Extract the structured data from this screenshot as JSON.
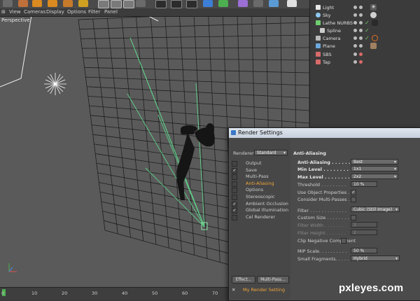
{
  "menu": {
    "items": [
      "View",
      "Cameras",
      "Display",
      "Options",
      "Filter",
      "Panel"
    ]
  },
  "viewport": {
    "label": "Perspective"
  },
  "timeline": {
    "ticks": [
      "0",
      "10",
      "20",
      "30",
      "40",
      "50",
      "60",
      "70"
    ]
  },
  "objects": [
    {
      "name": "Light",
      "icon_color": "#e8e8e8",
      "tag": "star"
    },
    {
      "name": "Sky",
      "icon_color": "#8ec8f0",
      "tag": "sphere"
    },
    {
      "name": "Lathe NURBS",
      "icon_color": "#6fcf6f",
      "tag": "check"
    },
    {
      "name": "Spline",
      "icon_color": "#cccccc",
      "tag": "check"
    },
    {
      "name": "Camera",
      "icon_color": "#bbbbbb",
      "tag": "no"
    },
    {
      "name": "Plane",
      "icon_color": "#6fa8dc",
      "tag": "texture"
    },
    {
      "name": "SBS",
      "icon_color": "#d96a6a",
      "tag": ""
    },
    {
      "name": "Tap",
      "icon_color": "#d96a6a",
      "tag": ""
    }
  ],
  "render": {
    "title": "Render Settings",
    "renderer_label": "Renderer",
    "renderer_value": "Standard",
    "section": "Anti-Aliasing",
    "nav": [
      {
        "label": "Output",
        "checked": false,
        "active": false
      },
      {
        "label": "Save",
        "checked": true,
        "active": false
      },
      {
        "label": "Multi-Pass",
        "checked": false,
        "active": false
      },
      {
        "label": "Anti-Aliasing",
        "checked": false,
        "active": true
      },
      {
        "label": "Options",
        "checked": false,
        "active": false
      },
      {
        "label": "Stereoscopic",
        "checked": false,
        "active": false
      },
      {
        "label": "Ambient Occlusion",
        "checked": true,
        "active": false
      },
      {
        "label": "Global Illumination",
        "checked": true,
        "active": false
      },
      {
        "label": "Cel Renderer",
        "checked": false,
        "active": false
      }
    ],
    "anti_aliasing_label": "Anti-Aliasing . . . . . . .",
    "anti_aliasing_value": "Best",
    "min_level_label": "Min Level . . . . . . . . .",
    "min_level_value": "1x1",
    "max_level_label": "Max Level . . . . . . . .",
    "max_level_value": "2x2",
    "threshold_label": "Threshold . . . . . . . . .",
    "threshold_value": "10 %",
    "use_object_label": "Use Object Properties . .",
    "consider_multipass_label": "Consider Multi-Passes . .",
    "filter_label": "Filter . . . . . . . . . . . . .",
    "filter_value": "Cubic (Still Image)",
    "custom_size_label": "Custom Size . . . . . . . .",
    "filter_width_label": "Filter Width . . . . . . . .",
    "filter_width_value": "2",
    "filter_height_label": "Filter Height . . . . . . .",
    "filter_height_value": "2",
    "clip_negative_label": "Clip Negative Component",
    "mip_scale_label": "MIP Scale. . . . . . . . . .",
    "mip_scale_value": "50 %",
    "small_fragments_label": "Small Fragments. . . . . .",
    "small_fragments_value": "Hybrid",
    "effect_button": "Effect...",
    "multipass_button": "Multi-Pass...",
    "setting_name": "My Render Setting"
  },
  "watermark": "pxleyes.com"
}
